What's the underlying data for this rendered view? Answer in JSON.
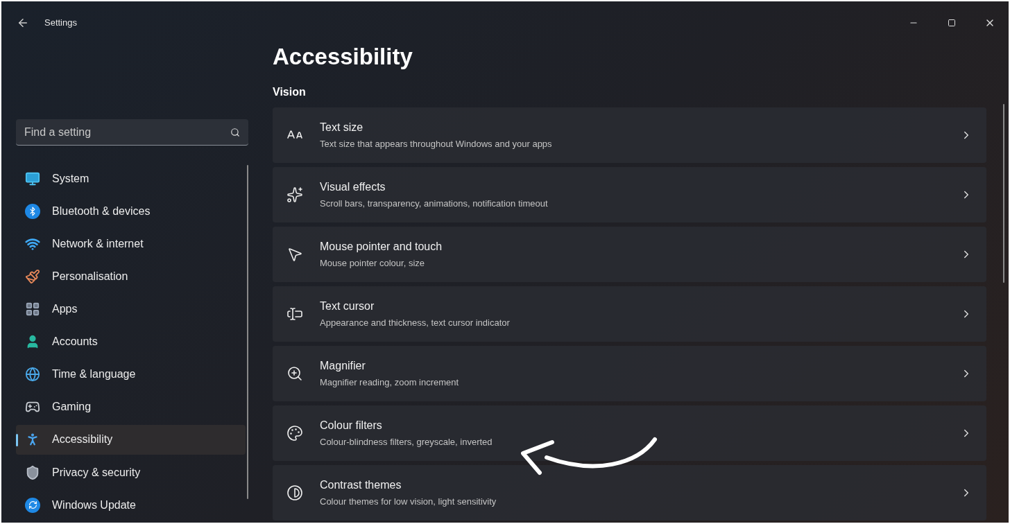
{
  "window": {
    "title": "Settings"
  },
  "search": {
    "placeholder": "Find a setting"
  },
  "sidebar": {
    "items": [
      {
        "label": "System",
        "selected": false
      },
      {
        "label": "Bluetooth & devices",
        "selected": false
      },
      {
        "label": "Network & internet",
        "selected": false
      },
      {
        "label": "Personalisation",
        "selected": false
      },
      {
        "label": "Apps",
        "selected": false
      },
      {
        "label": "Accounts",
        "selected": false
      },
      {
        "label": "Time & language",
        "selected": false
      },
      {
        "label": "Gaming",
        "selected": false
      },
      {
        "label": "Accessibility",
        "selected": true
      },
      {
        "label": "Privacy & security",
        "selected": false
      },
      {
        "label": "Windows Update",
        "selected": false
      }
    ]
  },
  "page": {
    "title": "Accessibility",
    "section": "Vision",
    "items": [
      {
        "title": "Text size",
        "description": "Text size that appears throughout Windows and your apps"
      },
      {
        "title": "Visual effects",
        "description": "Scroll bars, transparency, animations, notification timeout"
      },
      {
        "title": "Mouse pointer and touch",
        "description": "Mouse pointer colour, size"
      },
      {
        "title": "Text cursor",
        "description": "Appearance and thickness, text cursor indicator"
      },
      {
        "title": "Magnifier",
        "description": "Magnifier reading, zoom increment"
      },
      {
        "title": "Colour filters",
        "description": "Colour-blindness filters, greyscale, inverted"
      },
      {
        "title": "Contrast themes",
        "description": "Colour themes for low vision, light sensitivity"
      }
    ]
  }
}
